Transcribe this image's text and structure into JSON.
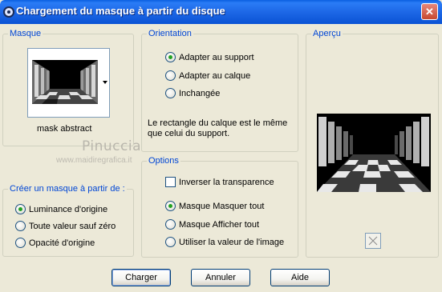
{
  "window": {
    "title": "Chargement du masque à partir du disque",
    "close_label": "✕"
  },
  "masque": {
    "label": "Masque",
    "thumbnail_name": "mask abstract"
  },
  "orientation": {
    "label": "Orientation",
    "options": [
      "Adapter au support",
      "Adapter au calque",
      "Inchangée"
    ],
    "selected": "Adapter au support",
    "description": "Le rectangle du calque est le même que celui du support."
  },
  "apercu": {
    "label": "Aperçu"
  },
  "creer": {
    "label": "Créer un masque à partir de :",
    "options": [
      "Luminance d'origine",
      "Toute valeur sauf zéro",
      "Opacité d'origine"
    ],
    "selected": "Luminance d'origine"
  },
  "options_group": {
    "label": "Options",
    "invert_label": "Inverser la transparence",
    "invert_checked": false,
    "radios": [
      "Masque Masquer tout",
      "Masque Afficher tout",
      "Utiliser la valeur de l'image"
    ],
    "selected": "Masque Masquer tout"
  },
  "watermark": {
    "name": "Pinuccia",
    "url": "www.maidiregrafica.it"
  },
  "buttons": {
    "charger": "Charger",
    "annuler": "Annuler",
    "aide": "Aide"
  },
  "colors": {
    "accent": "#0046d5",
    "titlebar": "#0a5fe0",
    "background": "#ece9d8",
    "radio_dot": "#21a121"
  }
}
